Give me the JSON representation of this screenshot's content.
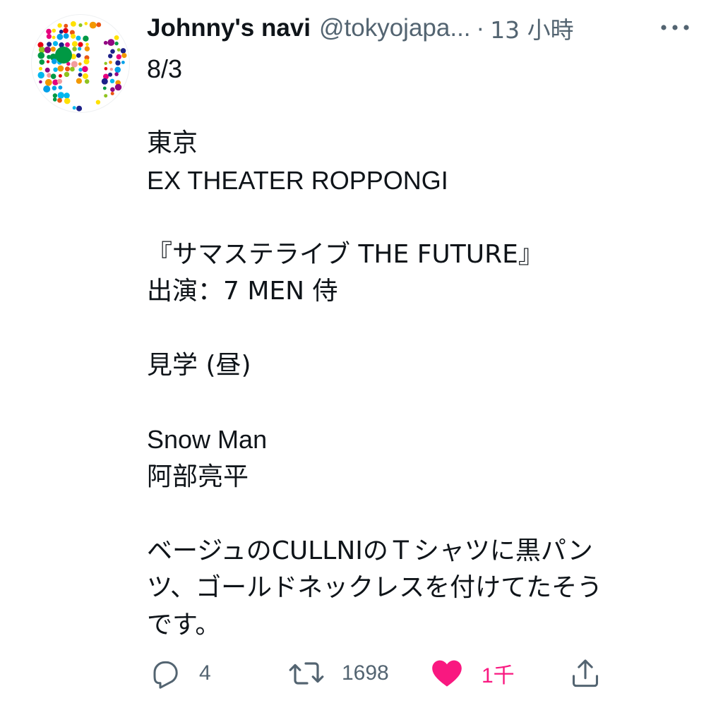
{
  "tweet": {
    "author": {
      "display_name": "Johnny's navi",
      "handle": "@tokyojapa...",
      "avatar_icon": "johnnys-dots-logo-icon"
    },
    "separator": "·",
    "timestamp": "13 小時",
    "more_icon": "more-horizontal-icon",
    "lines": [
      {
        "text": "8/3",
        "script": "latin"
      },
      {
        "text": "",
        "script": "latin"
      },
      {
        "text": "東京",
        "script": "cjk"
      },
      {
        "text": "EX THEATER ROPPONGI",
        "script": "latin"
      },
      {
        "text": "",
        "script": "latin"
      },
      {
        "text": "『サマステライブ THE FUTURE』",
        "script": "cjk"
      },
      {
        "text": "出演：7 MEN 侍",
        "script": "cjk"
      },
      {
        "text": "",
        "script": "latin"
      },
      {
        "text": "見学 (昼)",
        "script": "cjk"
      },
      {
        "text": "",
        "script": "latin"
      },
      {
        "text": "Snow Man",
        "script": "latin"
      },
      {
        "text": "阿部亮平",
        "script": "cjk"
      },
      {
        "text": "",
        "script": "latin"
      },
      {
        "text": "ベージュのCULLNIのＴシャツに黒パン",
        "script": "cjk"
      },
      {
        "text": "ツ、ゴールドネックレスを付けてたそう",
        "script": "cjk"
      },
      {
        "text": "です。",
        "script": "cjk"
      }
    ],
    "actions": {
      "reply": {
        "icon": "reply-icon",
        "count": "4"
      },
      "retweet": {
        "icon": "retweet-icon",
        "count": "1698"
      },
      "like": {
        "icon": "heart-filled-icon",
        "count": "1千",
        "liked": true
      },
      "share": {
        "icon": "share-icon",
        "count": ""
      }
    },
    "colors": {
      "text_primary": "#0f1419",
      "text_secondary": "#536471",
      "like_active": "#f91880"
    }
  }
}
